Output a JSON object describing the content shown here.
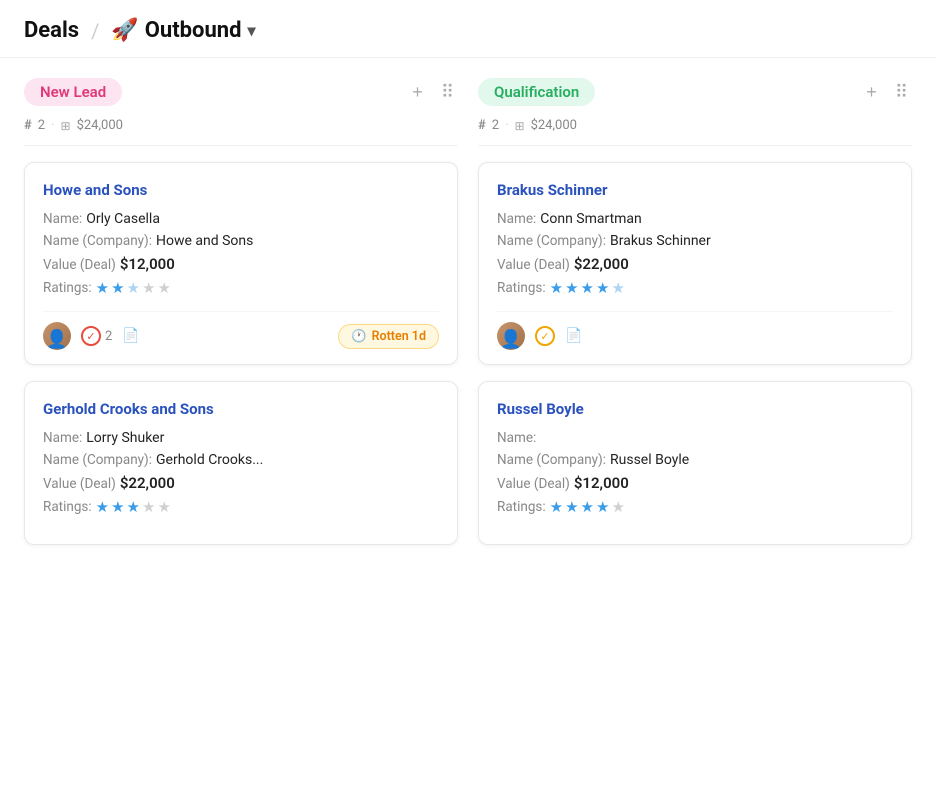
{
  "header": {
    "title": "Deals",
    "separator": "/",
    "rocket_emoji": "🚀",
    "pipeline_name": "Outbound",
    "chevron": "▾"
  },
  "columns": [
    {
      "id": "new-lead",
      "title": "New Lead",
      "badge_style": "pink",
      "stats": {
        "count": "2",
        "amount": "$24,000"
      },
      "cards": [
        {
          "id": "howe-sons",
          "title": "Howe and Sons",
          "name_label": "Name:",
          "name_value": "Orly Casella",
          "company_label": "Name (Company):",
          "company_value": "Howe and Sons",
          "value_label": "Value (Deal)",
          "value_value": "$12,000",
          "ratings_label": "Ratings:",
          "ratings": 2.5,
          "ratings_filled": 2,
          "ratings_half": 1,
          "ratings_total": 5,
          "footer": {
            "has_avatar": true,
            "check_count": "2",
            "is_rotten": true,
            "rotten_label": "Rotten 1d",
            "check_style": "red"
          }
        },
        {
          "id": "gerhold-crooks",
          "title": "Gerhold Crooks and Sons",
          "name_label": "Name:",
          "name_value": "Lorry Shuker",
          "company_label": "Name (Company):",
          "company_value": "Gerhold Crooks...",
          "value_label": "Value (Deal)",
          "value_value": "$22,000",
          "ratings_label": "Ratings:",
          "ratings_filled": 3,
          "ratings_half": 0,
          "ratings_total": 5,
          "footer": {
            "has_avatar": false,
            "check_count": "",
            "is_rotten": false,
            "rotten_label": "",
            "check_style": "none"
          }
        }
      ]
    },
    {
      "id": "qualification",
      "title": "Qualification",
      "badge_style": "green",
      "stats": {
        "count": "2",
        "amount": "$24,000"
      },
      "cards": [
        {
          "id": "brakus-schinner",
          "title": "Brakus Schinner",
          "name_label": "Name:",
          "name_value": "Conn Smartman",
          "company_label": "Name (Company):",
          "company_value": "Brakus Schinner",
          "value_label": "Value (Deal)",
          "value_value": "$22,000",
          "ratings_label": "Ratings:",
          "ratings_filled": 4,
          "ratings_half": 1,
          "ratings_total": 5,
          "footer": {
            "has_avatar": true,
            "check_count": "",
            "is_rotten": false,
            "rotten_label": "",
            "check_style": "orange"
          }
        },
        {
          "id": "russel-boyle",
          "title": "Russel Boyle",
          "name_label": "Name:",
          "name_value": "",
          "company_label": "Name (Company):",
          "company_value": "Russel Boyle",
          "value_label": "Value (Deal)",
          "value_value": "$12,000",
          "ratings_label": "Ratings:",
          "ratings_filled": 4,
          "ratings_half": 0,
          "ratings_total": 5,
          "footer": {
            "has_avatar": false,
            "check_count": "",
            "is_rotten": false,
            "rotten_label": "",
            "check_style": "none"
          }
        }
      ]
    }
  ],
  "add_button_label": "+",
  "grid_icon": "⊞"
}
